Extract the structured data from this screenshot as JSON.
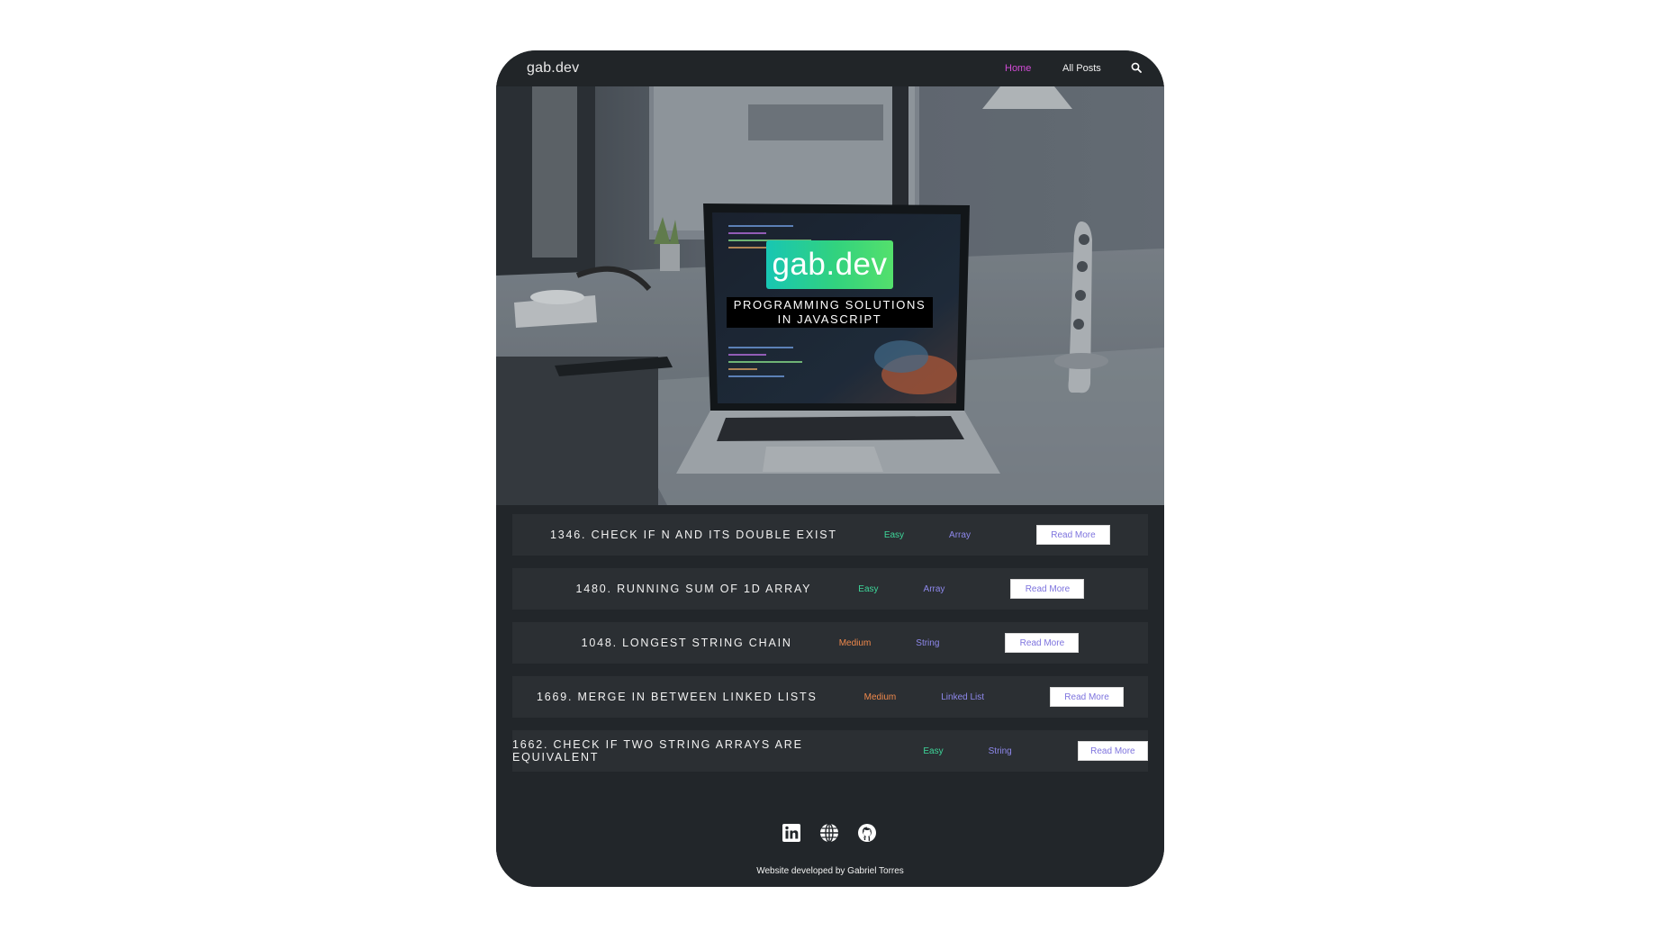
{
  "nav": {
    "brand": "gab.dev",
    "links": [
      "Home",
      "All Posts"
    ],
    "active": "Home",
    "search_icon": "search-icon"
  },
  "hero": {
    "logo": "gab.dev",
    "tagline_lines": [
      "PROGRAMMING SOLUTIONS",
      "IN JAVASCRIPT"
    ]
  },
  "posts": [
    {
      "title": "1346. Check if N and Its Double Exist",
      "difficulty": "Easy",
      "tag": "Array",
      "button": "Read More"
    },
    {
      "title": "1480. Running Sum of 1d Array",
      "difficulty": "Easy",
      "tag": "Array",
      "button": "Read More"
    },
    {
      "title": "1048. Longest String Chain",
      "difficulty": "Medium",
      "tag": "String",
      "button": "Read More"
    },
    {
      "title": "1669. Merge In Between Linked Lists",
      "difficulty": "Medium",
      "tag": "Linked List",
      "button": "Read More"
    },
    {
      "title": "1662. Check If Two String Arrays are Equivalent",
      "difficulty": "Easy",
      "tag": "String",
      "button": "Read More"
    }
  ],
  "footer": {
    "icons": [
      "linkedin-icon",
      "globe-icon",
      "github-icon"
    ],
    "credits": "Website developed by Gabriel Torres"
  },
  "colors": {
    "active_link": "#d24bd6",
    "easy": "#3ed79a",
    "medium": "#f0894c",
    "tag": "#8e88ec",
    "button_text": "#7d73de",
    "background": "#22262a"
  }
}
